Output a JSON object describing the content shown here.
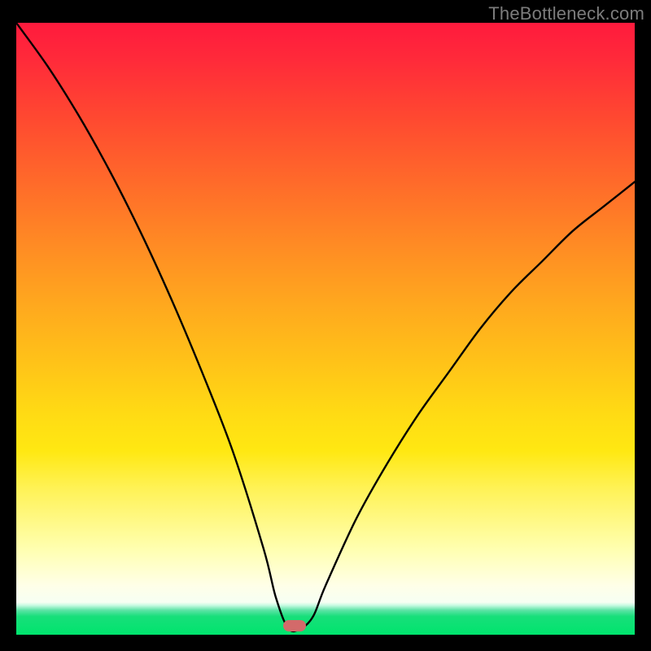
{
  "watermark": "TheBottleneck.com",
  "colors": {
    "curve_stroke": "#000000",
    "marker_fill": "#d36a6a",
    "gradient_stops": [
      "#ff1a3d",
      "#ff6a2a",
      "#ffc418",
      "#ffffb0",
      "#00e46d"
    ]
  },
  "chart_data": {
    "type": "line",
    "title": "",
    "xlabel": "",
    "ylabel": "",
    "xlim": [
      0,
      100
    ],
    "ylim": [
      0,
      100
    ],
    "annotations": [
      {
        "name": "min-marker",
        "x": 45,
        "y": 1.5
      }
    ],
    "series": [
      {
        "name": "bottleneck-curve",
        "x": [
          0,
          5,
          10,
          15,
          20,
          25,
          30,
          35,
          40,
          42,
          44,
          46,
          48,
          50,
          55,
          60,
          65,
          70,
          75,
          80,
          85,
          90,
          95,
          100
        ],
        "y": [
          100,
          93,
          85,
          76,
          66,
          55,
          43,
          30,
          14,
          6,
          1,
          1,
          3,
          8,
          19,
          28,
          36,
          43,
          50,
          56,
          61,
          66,
          70,
          74
        ]
      }
    ]
  }
}
